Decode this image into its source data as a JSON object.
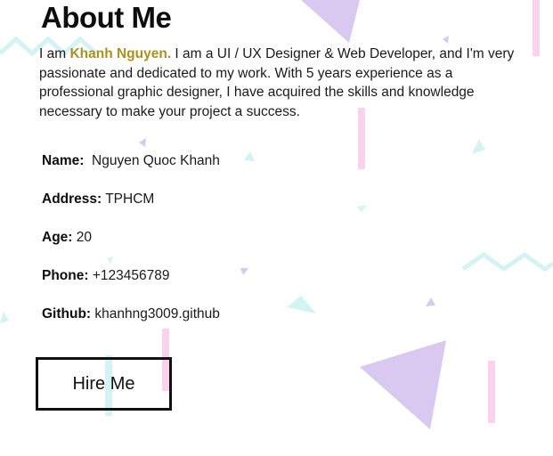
{
  "about": {
    "title": "About Me",
    "intro_prefix": "I am ",
    "intro_name": "Khanh Nguyen.",
    "intro_rest": " I am a UI / UX Designer & Web Developer, and I'm very passionate and dedicated to my work. With 5 years experience as a professional graphic designer, I have acquired the skills and knowledge necessary to make your project a success."
  },
  "info": {
    "name_label": "Name:",
    "name_value": "Nguyen Quoc Khanh",
    "address_label": "Address:",
    "address_value": "TPHCM",
    "age_label": "Age:",
    "age_value": "20",
    "phone_label": "Phone:",
    "phone_value": "+123456789",
    "github_label": "Github:",
    "github_value": "khanhng3009.github"
  },
  "buttons": {
    "hire_label": "Hire Me"
  },
  "colors": {
    "highlight": "#a8921d",
    "decor_purple": "#d9c8ef",
    "decor_pink": "#fbd2ec",
    "decor_cyan": "#d3f3f4"
  }
}
